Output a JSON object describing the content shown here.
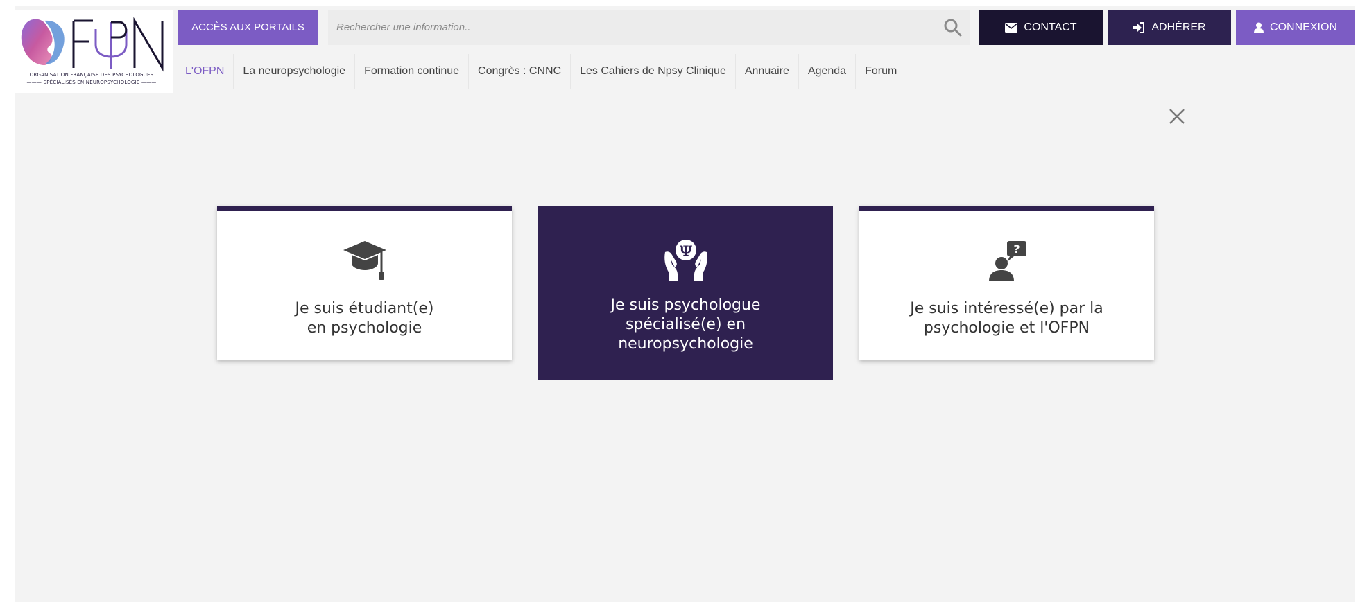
{
  "logo": {
    "mark": "OFPN",
    "tagline_line1": "ORGANISATION FRANÇAISE DES PSYCHOLOGUES",
    "tagline_line2": "SPÉCIALISÉS EN NEUROPSYCHOLOGIE"
  },
  "header": {
    "portals_label": "ACCÈS AUX PORTAILS",
    "search_placeholder": "Rechercher une information..",
    "contact_label": "CONTACT",
    "adherer_label": "ADHÉRER",
    "connexion_label": "CONNEXION"
  },
  "nav": {
    "items": [
      {
        "label": "L'OFPN"
      },
      {
        "label": "La neuropsychologie"
      },
      {
        "label": "Formation continue"
      },
      {
        "label": "Congrès : CNNC"
      },
      {
        "label": "Les Cahiers de Npsy Clinique"
      },
      {
        "label": "Annuaire"
      },
      {
        "label": "Agenda"
      },
      {
        "label": "Forum"
      }
    ]
  },
  "modal": {
    "cards": [
      {
        "line1": "Je suis étudiant(e)",
        "line2": "en psychologie",
        "icon": "graduation-cap-icon"
      },
      {
        "line1": "Je suis psychologue",
        "line2": "spécialisé(e) en",
        "line3": "neuropsychologie",
        "icon": "hands-psi-icon"
      },
      {
        "line1": "Je suis intéressé(e) par la",
        "line2": "psychologie et l'OFPN",
        "icon": "user-question-icon"
      }
    ]
  },
  "colors": {
    "primary_purple": "#7c5cc4",
    "dark_purple": "#2f2150",
    "contact_bg": "#1a1430",
    "background": "#f3f3f3"
  }
}
